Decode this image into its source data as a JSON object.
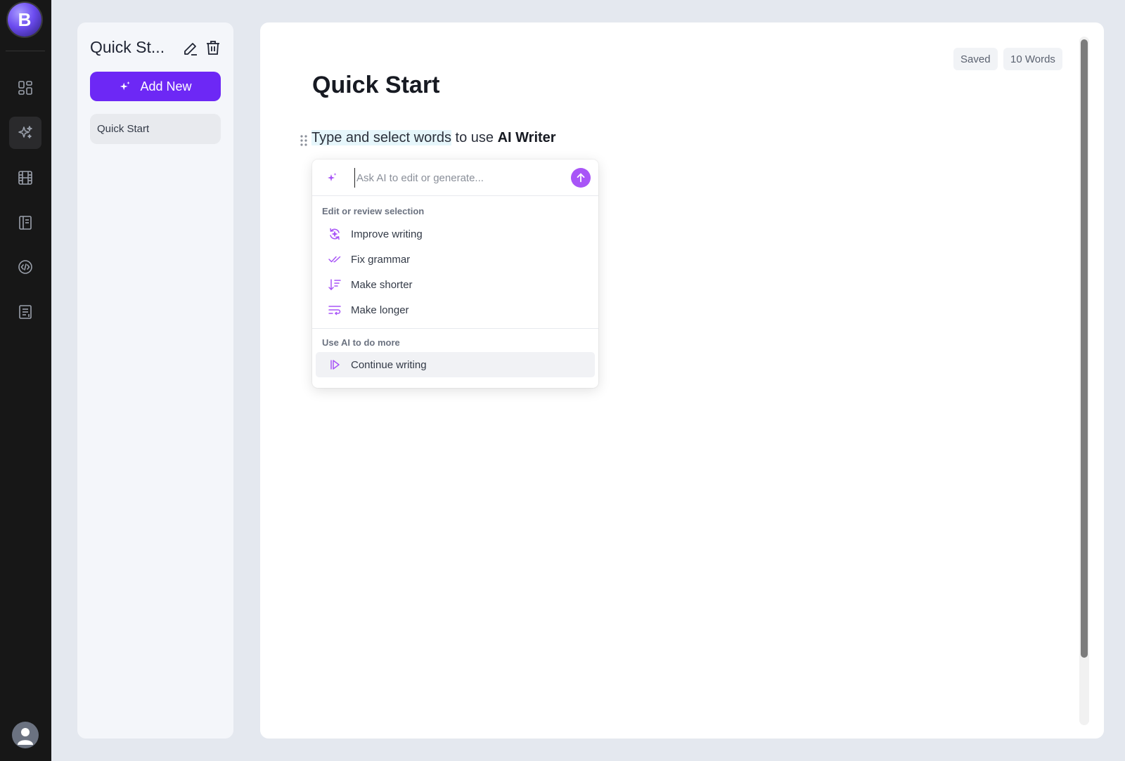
{
  "app": {
    "logo_letter": "B"
  },
  "doc_panel": {
    "title": "Quick St...",
    "add_new_label": "Add New",
    "documents": [
      {
        "label": "Quick Start"
      }
    ]
  },
  "editor": {
    "status_saved": "Saved",
    "word_count": "10 Words",
    "doc_title": "Quick Start",
    "paragraph": {
      "selected": "Type and select words",
      "middle": " to use ",
      "bold": "AI Writer"
    }
  },
  "ai_menu": {
    "placeholder": "Ask AI to edit or generate...",
    "section_edit": "Edit or review selection",
    "edit_items": [
      {
        "label": "Improve writing",
        "icon": "refresh-sparkle-icon"
      },
      {
        "label": "Fix grammar",
        "icon": "double-check-icon"
      },
      {
        "label": "Make shorter",
        "icon": "sort-shorter-icon"
      },
      {
        "label": "Make longer",
        "icon": "wrap-text-icon"
      }
    ],
    "section_more": "Use AI to do more",
    "more_items": [
      {
        "label": "Continue writing",
        "icon": "play-forward-icon"
      }
    ]
  },
  "colors": {
    "accent": "#6d28f5",
    "ai_purple": "#a855f7",
    "rail_bg": "#171717"
  }
}
